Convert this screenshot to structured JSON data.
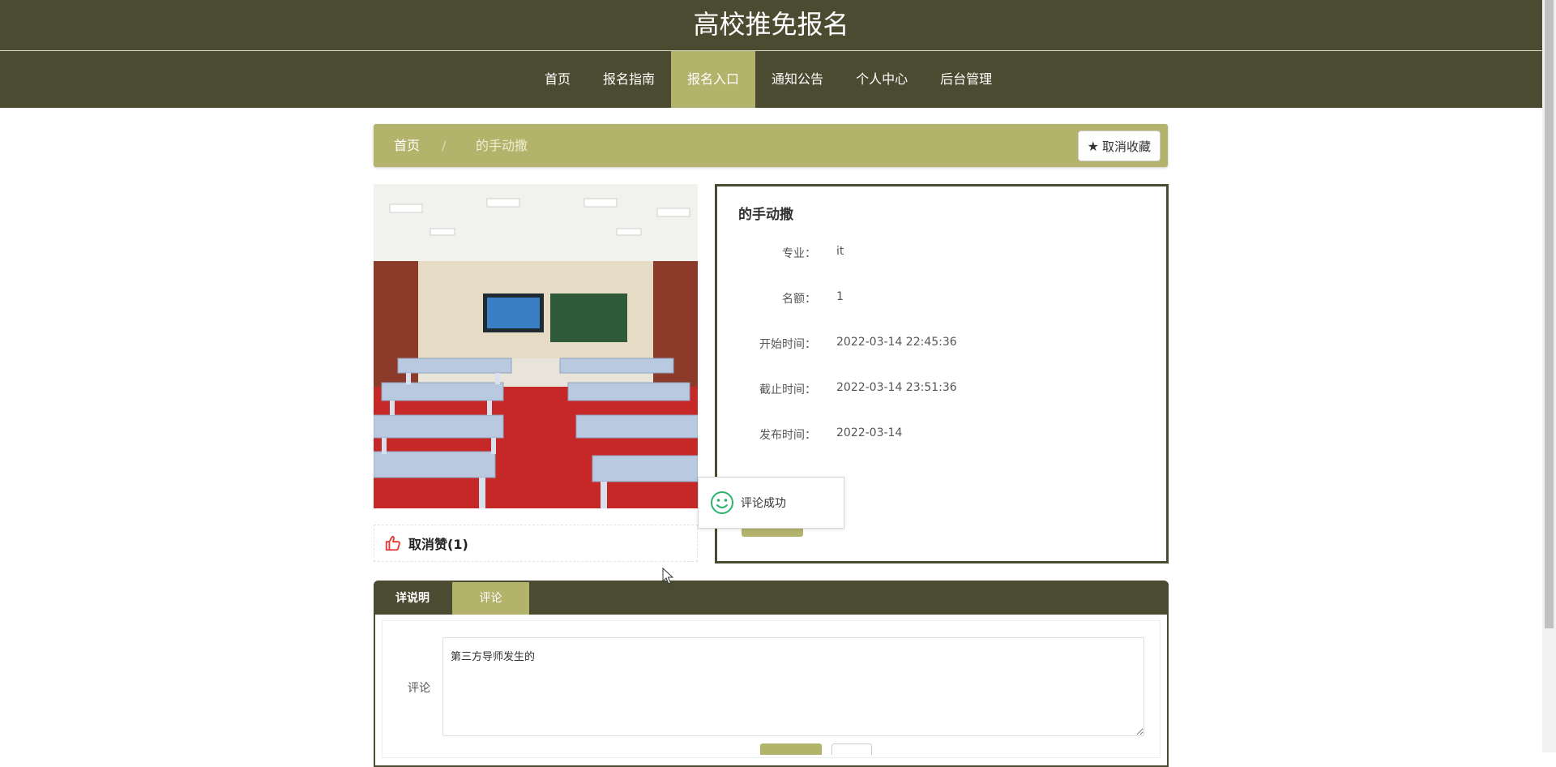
{
  "header": {
    "title": "高校推免报名"
  },
  "nav": {
    "items": [
      {
        "label": "首页"
      },
      {
        "label": "报名指南"
      },
      {
        "label": "报名入口"
      },
      {
        "label": "通知公告"
      },
      {
        "label": "个人中心"
      },
      {
        "label": "后台管理"
      }
    ],
    "active_index": 2
  },
  "breadcrumb": {
    "home": "首页",
    "separator": "/",
    "current": "的手动撒"
  },
  "favorite_button": {
    "label": "取消收藏",
    "icon": "star-icon"
  },
  "like": {
    "label": "取消赞(1)",
    "icon": "thumbs-up-icon"
  },
  "detail": {
    "title": "的手动撒",
    "rows": [
      {
        "label": "专业：",
        "value": "it"
      },
      {
        "label": "名额：",
        "value": "1"
      },
      {
        "label": "开始时间：",
        "value": "2022-03-14 22:45:36"
      },
      {
        "label": "截止时间：",
        "value": "2022-03-14 23:51:36"
      },
      {
        "label": "发布时间：",
        "value": "2022-03-14"
      }
    ]
  },
  "toast": {
    "message": "评论成功",
    "icon": "smile-icon"
  },
  "tabs": [
    {
      "label": "详说明"
    },
    {
      "label": "评论"
    }
  ],
  "active_tab_index": 1,
  "comment_form": {
    "label": "评论",
    "value": "第三方导师发生的"
  },
  "colors": {
    "header_bg": "#4b4b32",
    "accent": "#b3b36c"
  }
}
